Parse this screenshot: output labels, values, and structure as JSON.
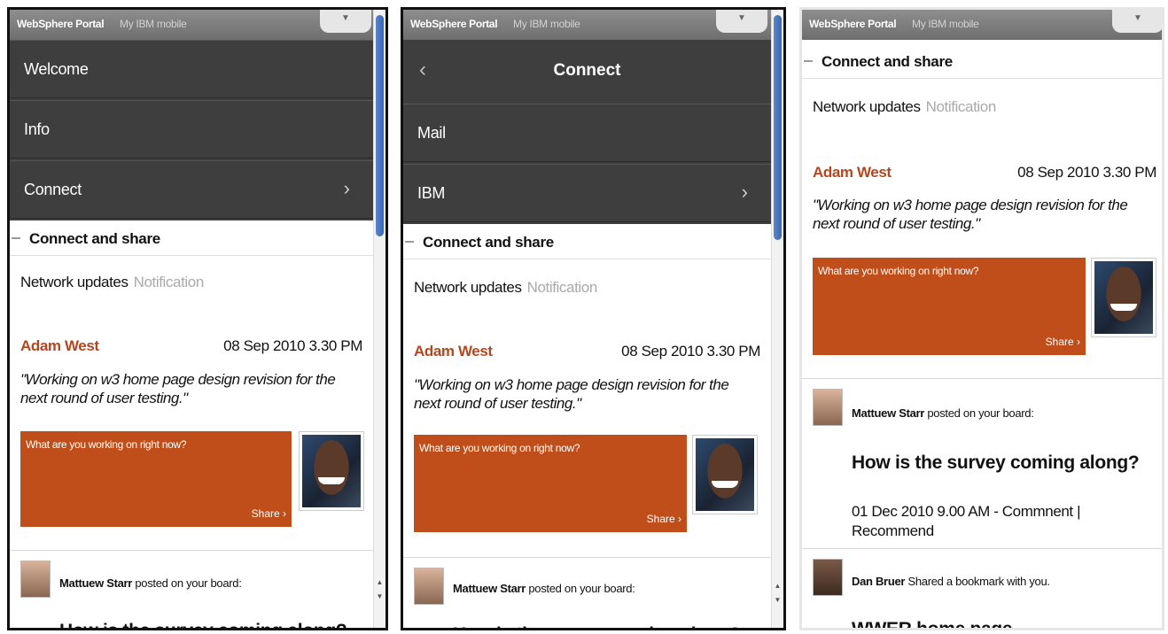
{
  "topbar": {
    "brand": "WebSphere Portal",
    "mobile": "My IBM mobile",
    "dropdown": "▼"
  },
  "screen1": {
    "nav": [
      {
        "label": "Welcome"
      },
      {
        "label": "Info"
      },
      {
        "label": "Connect",
        "chevron": "›"
      }
    ]
  },
  "screen2": {
    "nav_title": "Connect",
    "back": "‹",
    "nav": [
      {
        "label": "Mail"
      },
      {
        "label": "IBM",
        "chevron": "›"
      }
    ]
  },
  "section": {
    "title": "Connect and share"
  },
  "tabs": {
    "network": "Network updates",
    "notification": "Notification"
  },
  "update": {
    "author": "Adam West",
    "date": "08 Sep 2010 3.30 PM",
    "quote_l1": "\"Working on w3 home page design revision for the",
    "quote_l2": "next round of user testing.\""
  },
  "share_box": {
    "question": "What are you working on right now?",
    "share": "Share ›"
  },
  "post1": {
    "name": "Mattuew Starr",
    "action": " posted on your board:",
    "question": "How is the survey coming along?",
    "meta_l1": "01 Dec 2010 9.00 AM  -  Commnent |",
    "meta_l2": "Recommend"
  },
  "post2": {
    "name": "Dan Bruer",
    "action": " Shared a bookmark with you.",
    "title": "WWER home page"
  },
  "scroll": {
    "up": "▲",
    "down": "▼"
  }
}
